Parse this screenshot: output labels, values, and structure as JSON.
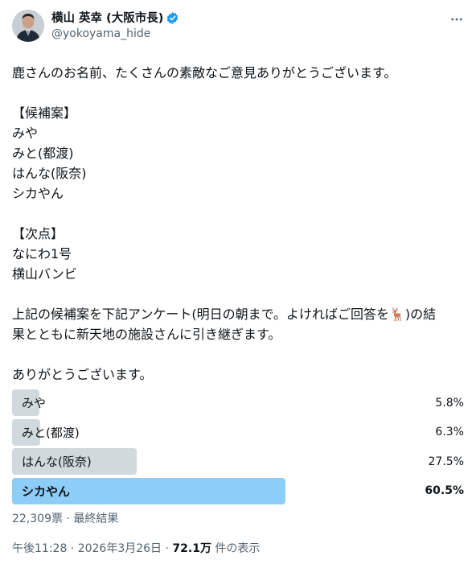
{
  "author": {
    "name": "横山 英幸 (大阪市長)",
    "handle": "@yokoyama_hide",
    "verified_color": "#1d9bf0"
  },
  "tweet": {
    "lines": [
      "鹿さんのお名前、たくさんの素敵なご意見ありがとうございます。",
      "",
      "【候補案】",
      "みや",
      "みと(都渡)",
      "はんな(阪奈)",
      "シカやん",
      "",
      "【次点】",
      "なにわ1号",
      "横山バンビ",
      "",
      "上記の候補案を下記アンケート(明日の朝まで。よければご回答を🦌)の結",
      "果とともに新天地の施設さんに引き継ぎます。",
      "",
      "ありがとうございます。"
    ]
  },
  "poll": {
    "options": [
      {
        "label": "みや",
        "percent_text": "5.8%",
        "percent": 5.8,
        "winner": false
      },
      {
        "label": "みと(都渡)",
        "percent_text": "6.3%",
        "percent": 6.3,
        "winner": false
      },
      {
        "label": "はんな(阪奈)",
        "percent_text": "27.5%",
        "percent": 27.5,
        "winner": false
      },
      {
        "label": "シカやん",
        "percent_text": "60.5%",
        "percent": 60.5,
        "winner": true
      }
    ],
    "summary": "22,309票 · 最終結果",
    "colors": {
      "bar": "#cfd9de",
      "winner_bar": "#8ecdf8"
    }
  },
  "meta": {
    "time": "午後11:28 · 2026年3月26日 · ",
    "views_count": "72.1万",
    "views_label": " 件の表示"
  },
  "icons": {
    "more": "more-dots-icon",
    "verified": "verified-badge-icon"
  }
}
